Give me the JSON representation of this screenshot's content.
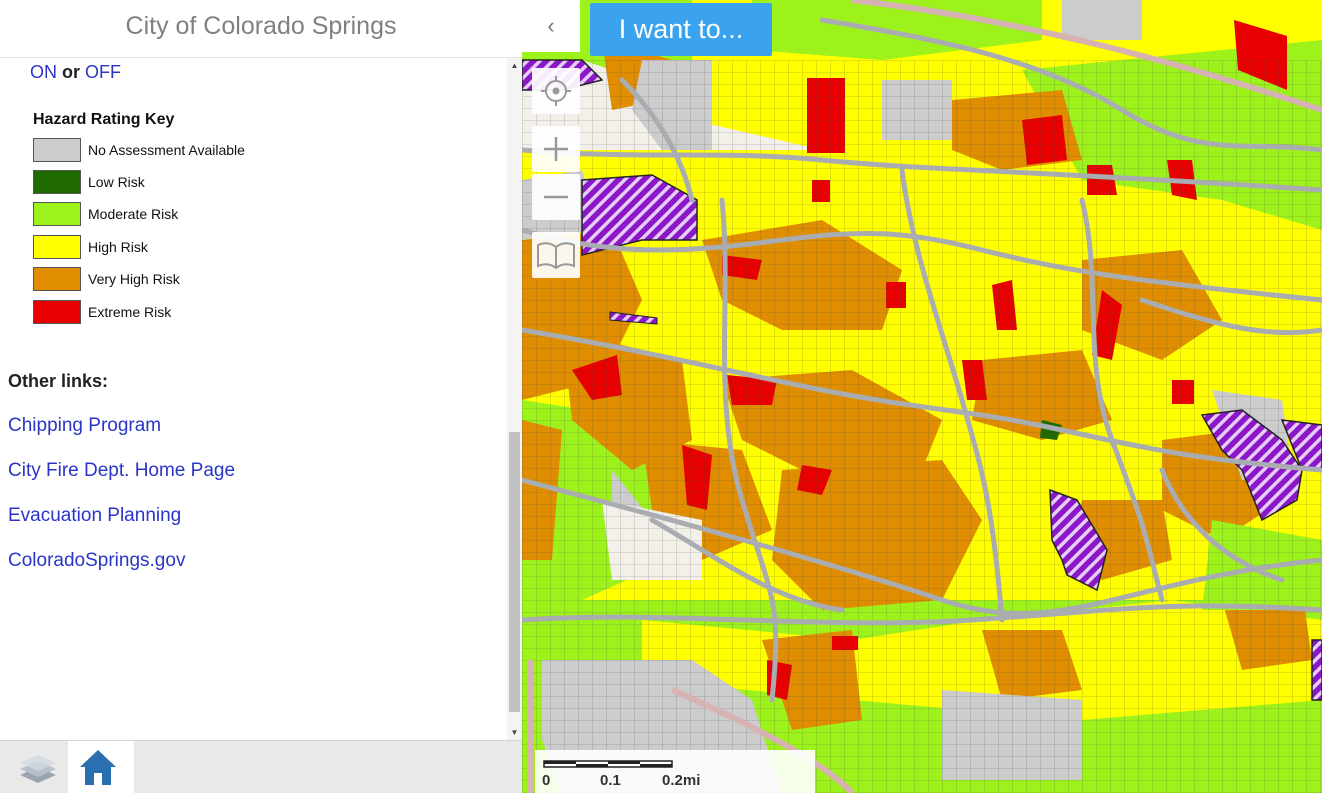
{
  "header": {
    "title": "City of Colorado Springs",
    "collapse_icon": "chevron-left-icon"
  },
  "toggle": {
    "on": "ON",
    "or": "or",
    "off": "OFF"
  },
  "legend": {
    "title": "Hazard Rating Key",
    "items": [
      {
        "label": "No Assessment Available",
        "color": "#cccccc"
      },
      {
        "label": "Low Risk",
        "color": "#1f6b00"
      },
      {
        "label": "Moderate Risk",
        "color": "#9cf21a"
      },
      {
        "label": "High Risk",
        "color": "#ffff00"
      },
      {
        "label": "Very High Risk",
        "color": "#e08e00"
      },
      {
        "label": "Extreme Risk",
        "color": "#e80000"
      }
    ]
  },
  "other_links": {
    "title": "Other links:",
    "links": [
      "Chipping Program",
      "City Fire Dept. Home Page",
      "Evacuation Planning",
      "ColoradoSprings.gov"
    ]
  },
  "toolbar": {
    "i_want_to": "I want to..."
  },
  "map_controls": [
    "locate-icon",
    "zoom-in-icon",
    "zoom-out-icon",
    "bookmarks-icon"
  ],
  "footer": [
    "layers-icon",
    "home-icon"
  ],
  "scale_bar": {
    "labels": [
      "0",
      "0.1",
      "0.2mi"
    ]
  }
}
